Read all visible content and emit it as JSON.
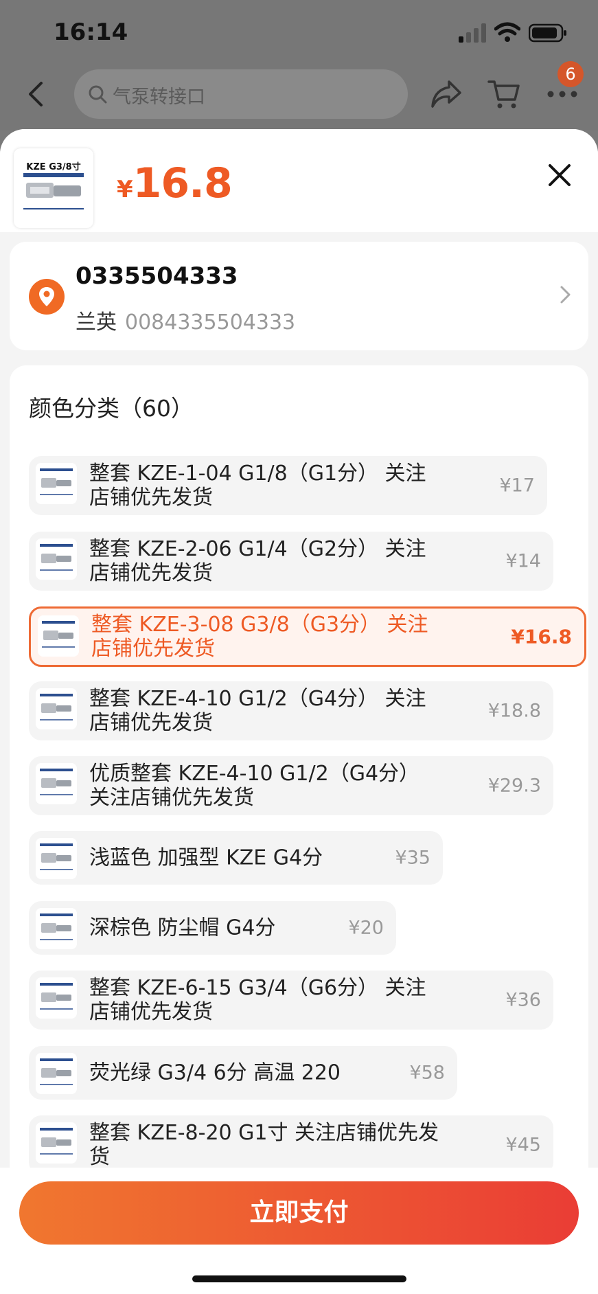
{
  "status_bar": {
    "time": "16:14"
  },
  "top_nav": {
    "search_placeholder": "气泵转接口",
    "cart_badge": "6"
  },
  "header": {
    "thumb_label": "KZE G3/8寸",
    "price_symbol": "¥",
    "price_value": "16.8"
  },
  "address": {
    "phone": "0335504333",
    "name": "兰英",
    "number": "0084335504333"
  },
  "options": {
    "title": "颜色分类（60）",
    "items": [
      {
        "label": "整套 KZE-1-04 G1/8（G1分） 关注店铺优先发货",
        "price": "¥17",
        "selected": false
      },
      {
        "label": "整套 KZE-2-06 G1/4（G2分） 关注店铺优先发货",
        "price": "¥14",
        "selected": false
      },
      {
        "label": "整套 KZE-3-08 G3/8（G3分） 关注店铺优先发货",
        "price": "¥16.8",
        "selected": true
      },
      {
        "label": "整套 KZE-4-10 G1/2（G4分） 关注店铺优先发货",
        "price": "¥18.8",
        "selected": false
      },
      {
        "label": "优质整套 KZE-4-10 G1/2（G4分） 关注店铺优先发货",
        "price": "¥29.3",
        "selected": false
      },
      {
        "label": "浅蓝色 加强型 KZE G4分",
        "price": "¥35",
        "selected": false
      },
      {
        "label": "深棕色 防尘帽 G4分",
        "price": "¥20",
        "selected": false
      },
      {
        "label": "整套 KZE-6-15 G3/4（G6分） 关注店铺优先发货",
        "price": "¥36",
        "selected": false
      },
      {
        "label": "荧光绿 G3/4 6分 高温 220",
        "price": "¥58",
        "selected": false
      },
      {
        "label": "整套 KZE-8-20 G1寸 关注店铺优先发货",
        "price": "¥45",
        "selected": false
      }
    ]
  },
  "footer": {
    "pay_label": "立即支付"
  },
  "colors": {
    "accent": "#ee5a24",
    "pay_gradient_start": "#f0772f",
    "pay_gradient_end": "#ea3d35"
  }
}
